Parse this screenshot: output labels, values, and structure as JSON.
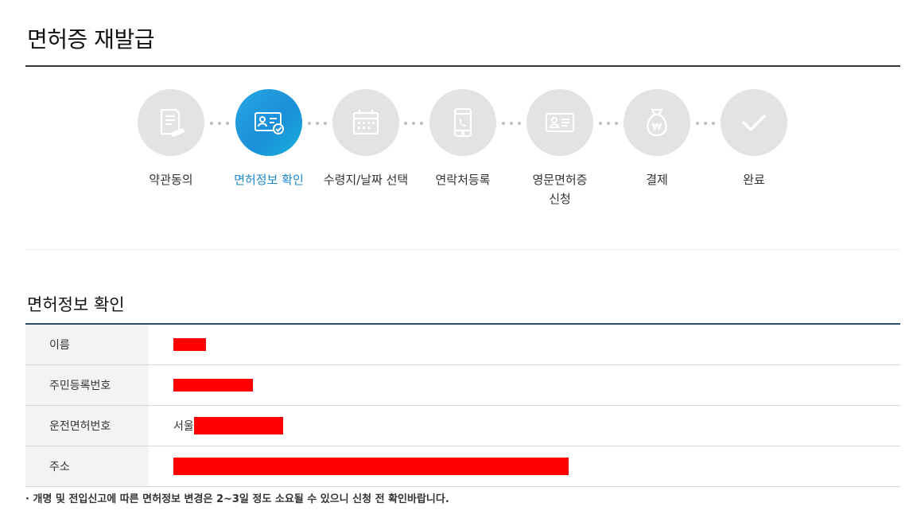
{
  "page_title": "면허증 재발급",
  "steps": [
    {
      "label": "약관동의",
      "icon": "document-sign-icon",
      "active": false
    },
    {
      "label": "면허정보 확인",
      "icon": "license-check-icon",
      "active": true
    },
    {
      "label": "수령지/날짜 선택",
      "icon": "calendar-icon",
      "active": false
    },
    {
      "label": "연락처등록",
      "icon": "phone-icon",
      "active": false
    },
    {
      "label": "영문면허증\n신청",
      "icon": "id-card-icon",
      "active": false
    },
    {
      "label": "결제",
      "icon": "money-bag-icon",
      "active": false
    },
    {
      "label": "완료",
      "icon": "checkmark-icon",
      "active": false
    }
  ],
  "section_title": "면허정보 확인",
  "info_rows": [
    {
      "label": "이름",
      "value_prefix": ""
    },
    {
      "label": "주민등록번호",
      "value_prefix": ""
    },
    {
      "label": "운전면허번호",
      "value_prefix": "서울"
    },
    {
      "label": "주소",
      "value_prefix": ""
    }
  ],
  "note": "· 개명 및 전입신고에 따른 면허정보 변경은 2~3일 정도 소요될 수 있으니 신청 전 확인바랍니다.",
  "colors": {
    "active_step": "#1b88d2",
    "inactive_circle": "#e3e3e3",
    "table_top_border": "#2c4f6b",
    "redaction": "#ff0000"
  }
}
